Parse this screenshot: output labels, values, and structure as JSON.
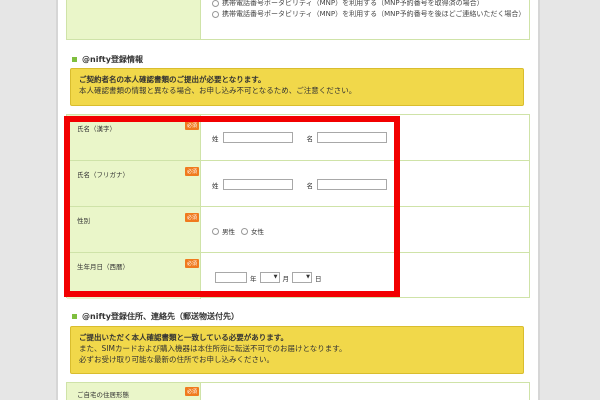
{
  "mnp": {
    "option1": "携帯電話番号ポータビリティ（MNP）を利用する（MNP予約番号を取得済の場合）",
    "option2": "携帯電話番号ポータビリティ（MNP）を利用する（MNP予約番号を後ほどご連絡いただく場合）"
  },
  "section1": {
    "title": "@nifty登録情報",
    "notice_heading": "ご契約者名の本人確認書類のご提出が必要となります。",
    "notice_body": "本人確認書類の情報と異なる場合、お申し込み不可となるため、ご注意ください。"
  },
  "form": {
    "required_label": "必須",
    "name_kanji": {
      "label": "氏名（漢字）",
      "sei": "姓",
      "mei": "名"
    },
    "name_kana": {
      "label": "氏名（フリガナ）",
      "sei": "姓",
      "mei": "名"
    },
    "gender": {
      "label": "性別",
      "male": "男性",
      "female": "女性"
    },
    "birthday": {
      "label": "生年月日（西暦）",
      "year": "年",
      "month": "月",
      "day": "日"
    }
  },
  "section2": {
    "title": "@nifty登録住所、連絡先（郵送物送付先）",
    "notice_heading": "ご提出いただく本人確認書類と一致している必要があります。",
    "notice_line1": "また、SIMカードおよび購入機器は本住所宛に転送不可でのお届けとなります。",
    "notice_line2": "必ずお受け取り可能な最新の住所でお申し込みください。"
  },
  "address": {
    "label": "ご自宅の住居形態"
  }
}
